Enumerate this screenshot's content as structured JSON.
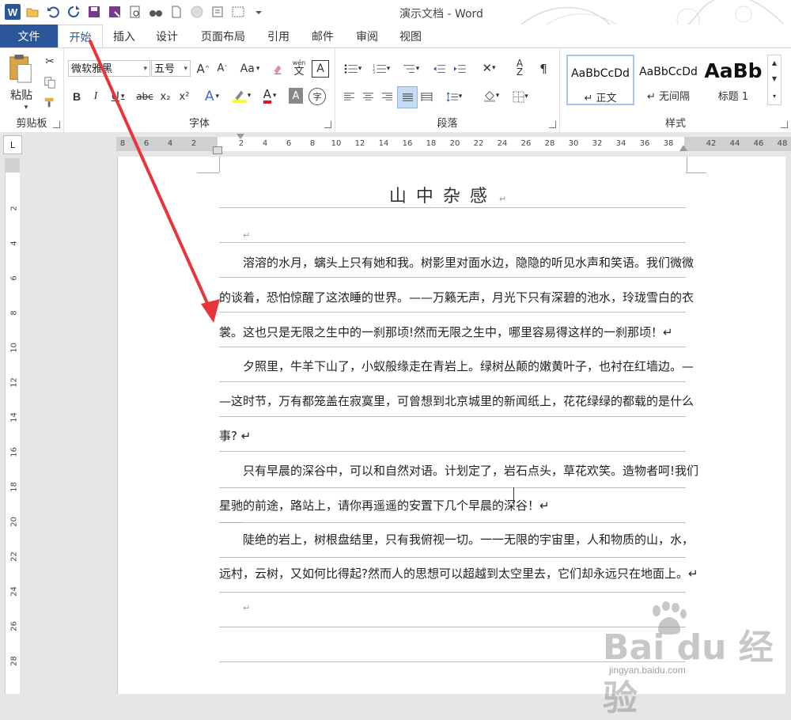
{
  "window": {
    "title": "演示文档 - Word"
  },
  "tabs": {
    "file": "文件",
    "items": [
      "开始",
      "插入",
      "设计",
      "页面布局",
      "引用",
      "邮件",
      "审阅",
      "视图"
    ]
  },
  "ribbon": {
    "clipboard": {
      "label": "剪贴板",
      "paste": "粘贴"
    },
    "font": {
      "label": "字体",
      "font_name": "微软雅黑",
      "font_size": "五号",
      "aa": "Aa",
      "phonetic_top": "wén",
      "phonetic_bottom": "文",
      "bold": "B",
      "italic": "I",
      "underline": "U",
      "strike": "abc",
      "sub": "x₂",
      "sup": "x²"
    },
    "paragraph": {
      "label": "段落"
    },
    "styles": {
      "label": "样式",
      "items": [
        {
          "sample": "AaBbCcDd",
          "name": "↵ 正文"
        },
        {
          "sample": "AaBbCcDd",
          "name": "↵ 无间隔"
        },
        {
          "sample": "AaBb",
          "name": "标题 1"
        }
      ]
    }
  },
  "ruler": {
    "h_numbers": [
      "8",
      "6",
      "4",
      "2",
      "2",
      "4",
      "6",
      "8",
      "10",
      "12",
      "14",
      "16",
      "18",
      "20",
      "22",
      "24",
      "26",
      "28",
      "30",
      "32",
      "34",
      "36",
      "38",
      "42",
      "44",
      "46",
      "48"
    ],
    "v_numbers": [
      "2",
      "4",
      "6",
      "8",
      "10",
      "12",
      "14",
      "16",
      "18",
      "20",
      "22",
      "24",
      "26",
      "28"
    ],
    "corner": "L"
  },
  "document": {
    "heading": "山中杂感",
    "lines": [
      "↵",
      "　　溶溶的水月，螭头上只有她和我。树影里对面水边，隐隐的听见水声和笑语。我们微微",
      "的谈着，恐怕惊醒了这浓睡的世界。——万籁无声，月光下只有深碧的池水，玲珑雪白的衣",
      "裳。这也只是无限之生中的一刹那顷!然而无限之生中，哪里容易得这样的一刹那顷！↵",
      "　　夕照里，牛羊下山了，小蚁般缘走在青岩上。绿树丛颠的嫩黄叶子，也衬在红墙边。—",
      "—这时节，万有都笼盖在寂寞里，可曾想到北京城里的新闻纸上，花花绿绿的都载的是什么",
      "事? ↵",
      "　　只有早晨的深谷中，可以和自然对语。计划定了，岩石点头，草花欢笑。造物者呵!我们",
      "星驰的前途，路站上，请你再遥遥的安置下几个早晨的深谷！↵",
      "　　陡绝的岩上，树根盘结里，只有我俯视一切。一一无限的宇宙里，人和物质的山，水，",
      "远村，云树，又如何比得起?然而人的思想可以超越到太空里去，它们却永远只在地面上。↵",
      "↵"
    ]
  },
  "watermark": {
    "main": "Bai du 经验",
    "sub": "jingyan.baidu.com"
  },
  "colors": {
    "accent": "#2b579a",
    "arrow": "#e8353a"
  }
}
